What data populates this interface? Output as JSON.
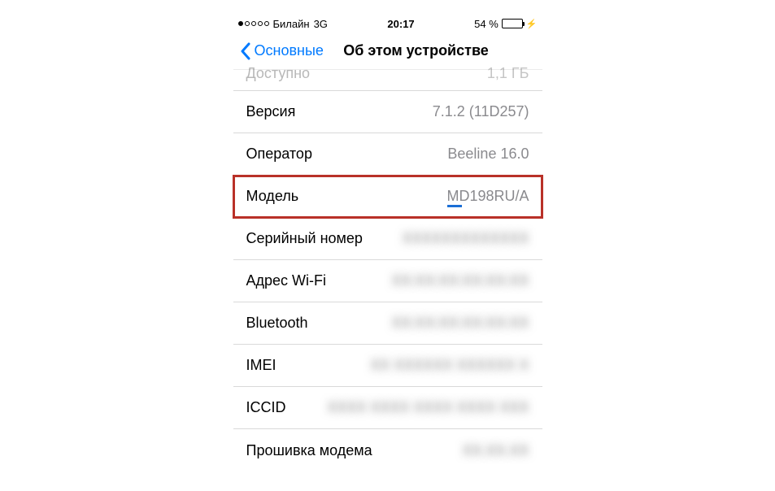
{
  "status": {
    "carrier": "Билайн",
    "network": "3G",
    "time": "20:17",
    "battery_text": "54 %",
    "battery_pct": 54
  },
  "nav": {
    "back_label": "Основные",
    "title": "Об этом устройстве"
  },
  "peek": {
    "label": "Доступно",
    "value": "1,1 ГБ"
  },
  "rows": {
    "version": {
      "label": "Версия",
      "value": "7.1.2 (11D257)"
    },
    "carrier": {
      "label": "Оператор",
      "value": "Beeline 16.0"
    },
    "model": {
      "label": "Модель",
      "value": "MD198RU/A"
    },
    "serial": {
      "label": "Серийный номер",
      "value": "XXXXXXXXXXXXX"
    },
    "wifi": {
      "label": "Адрес Wi-Fi",
      "value": "XX:XX:XX:XX:XX:XX"
    },
    "bluetooth": {
      "label": "Bluetooth",
      "value": "XX:XX:XX:XX:XX:XX"
    },
    "imei": {
      "label": "IMEI",
      "value": "XX XXXXXX XXXXXX X"
    },
    "iccid": {
      "label": "ICCID",
      "value": "XXXX XXXX XXXX XXXX XXX"
    },
    "modem": {
      "label": "Прошивка модема",
      "value": "XX.XX.XX"
    }
  }
}
